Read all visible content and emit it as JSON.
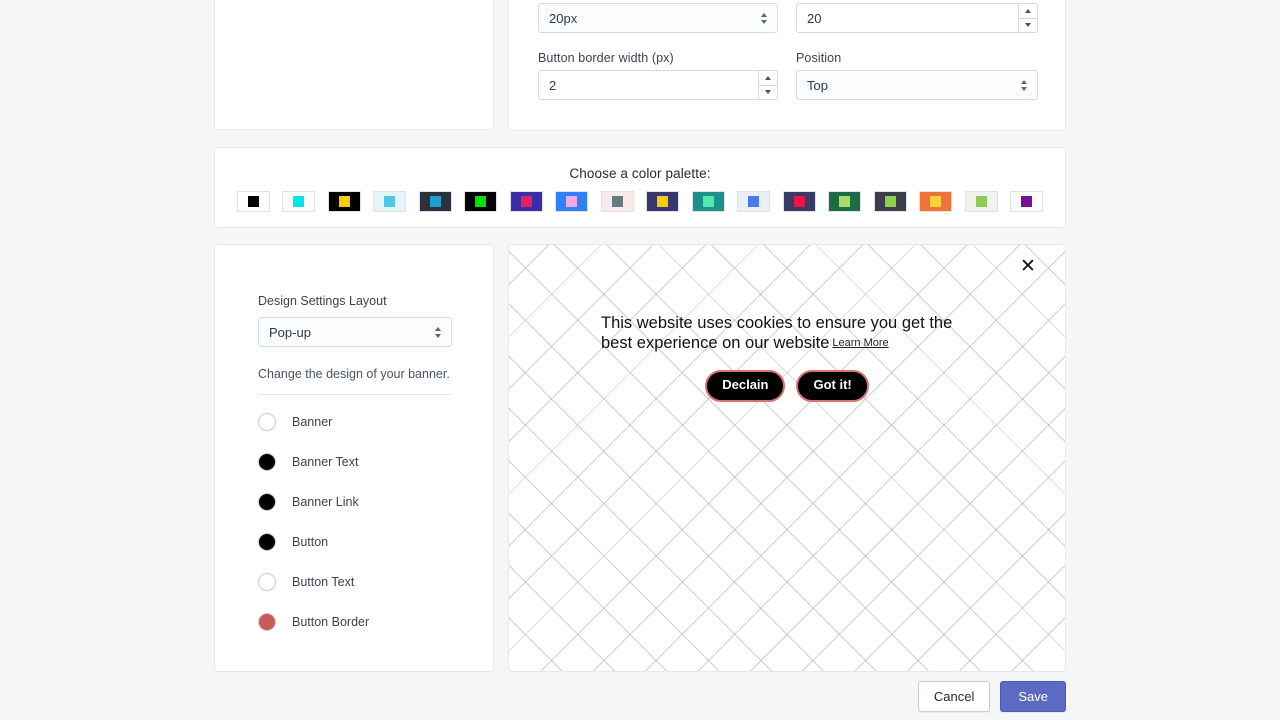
{
  "theme": {
    "page_bg": "#f4f6f8",
    "card_bg": "#ffffff",
    "card_border": "#e6e8eb",
    "save_button_bg": "#5c6ac4",
    "text_primary": "#212b36"
  },
  "settings_panel": {
    "fields": [
      {
        "name": "font_size",
        "label": "",
        "value": "20px",
        "control": "select"
      },
      {
        "name": "button_border_radius",
        "label": "",
        "value": "20",
        "control": "number"
      },
      {
        "name": "button_border_width",
        "label": "Button border width (px)",
        "value": "2",
        "control": "number"
      },
      {
        "name": "position",
        "label": "Position",
        "value": "Top",
        "control": "select"
      }
    ]
  },
  "palette_panel": {
    "title": "Choose a color palette:",
    "swatches": [
      {
        "bg": "#ffffff",
        "dot": "#000000"
      },
      {
        "bg": "#fdfcfa",
        "dot": "#00e5f0"
      },
      {
        "bg": "#000000",
        "dot": "#f5cc00"
      },
      {
        "bg": "#e5f4f6",
        "dot": "#4dc8e0"
      },
      {
        "bg": "#2b323d",
        "dot": "#1e9fd0"
      },
      {
        "bg": "#000000",
        "dot": "#00e000"
      },
      {
        "bg": "#3b2fa8",
        "dot": "#e81f62"
      },
      {
        "bg": "#2f7ff5",
        "dot": "#f3a8e8"
      },
      {
        "bg": "#f9e9e8",
        "dot": "#5f7d7c"
      },
      {
        "bg": "#393570",
        "dot": "#f5cc00"
      },
      {
        "bg": "#1b9189",
        "dot": "#4fe9aa"
      },
      {
        "bg": "#eceff5",
        "dot": "#4a7af0"
      },
      {
        "bg": "#373b63",
        "dot": "#f0114e"
      },
      {
        "bg": "#1d6b40",
        "dot": "#a9dd68"
      },
      {
        "bg": "#3b3f4b",
        "dot": "#8bd44a"
      },
      {
        "bg": "#ed7338",
        "dot": "#f5d33f"
      },
      {
        "bg": "#f0f2f0",
        "dot": "#8ccc55"
      },
      {
        "bg": "#fdfcfc",
        "dot": "#7b0f93"
      }
    ]
  },
  "design_panel": {
    "layout_label": "Design Settings Layout",
    "layout_value": "Pop-up",
    "help_text": "Change the design of your banner.",
    "color_items": [
      {
        "label": "Banner",
        "color": "#ffffff"
      },
      {
        "label": "Banner Text",
        "color": "#000000"
      },
      {
        "label": "Banner Link",
        "color": "#000000"
      },
      {
        "label": "Button",
        "color": "#000000"
      },
      {
        "label": "Button Text",
        "color": "#ffffff"
      },
      {
        "label": "Button Border",
        "color": "#cb5a57"
      }
    ]
  },
  "preview": {
    "close_icon": "✕",
    "message": "This website uses cookies to ensure you get the best experience on our website",
    "learn_more": "Learn More",
    "decline_button": "Declain",
    "accept_button": "Got it!"
  },
  "footer": {
    "cancel_label": "Cancel",
    "save_label": "Save"
  }
}
